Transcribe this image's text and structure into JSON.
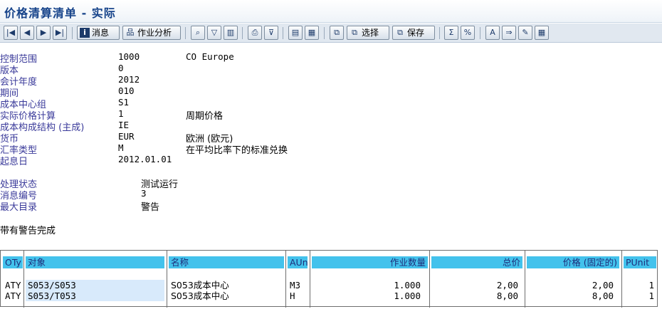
{
  "window": {
    "title": "价格清算清单 - 实际"
  },
  "toolbar": {
    "buttons": [
      {
        "icon": "first-page-icon",
        "glyph": "|◀",
        "label": ""
      },
      {
        "icon": "prev-page-icon",
        "glyph": "◀",
        "label": ""
      },
      {
        "icon": "next-page-icon",
        "glyph": "▶",
        "label": ""
      },
      {
        "icon": "last-page-icon",
        "glyph": "▶|",
        "label": ""
      },
      {
        "icon": "info-icon",
        "glyph": "i",
        "label": "消息"
      },
      {
        "icon": "hierarchy-icon",
        "glyph": "品",
        "label": "作业分析"
      },
      {
        "icon": "find-icon",
        "glyph": "⌕",
        "label": ""
      },
      {
        "icon": "filter-icon",
        "glyph": "▽",
        "label": ""
      },
      {
        "icon": "columns-icon",
        "glyph": "▥",
        "label": ""
      },
      {
        "icon": "print-icon",
        "glyph": "⎙",
        "label": ""
      },
      {
        "icon": "sort-filter-icon",
        "glyph": "⊽",
        "label": ""
      },
      {
        "icon": "export-icon",
        "glyph": "▤",
        "label": ""
      },
      {
        "icon": "export-list-icon",
        "glyph": "▦",
        "label": ""
      },
      {
        "icon": "copy-icon",
        "glyph": "⧉",
        "label": ""
      },
      {
        "icon": "select-layout-icon",
        "glyph": "⧉",
        "label": "选择"
      },
      {
        "icon": "save-layout-icon",
        "glyph": "⧉",
        "label": "保存"
      },
      {
        "icon": "sum-icon",
        "glyph": "Σ",
        "label": ""
      },
      {
        "icon": "subtotal-icon",
        "glyph": "%",
        "label": ""
      },
      {
        "icon": "abc-icon",
        "glyph": "A",
        "label": ""
      },
      {
        "icon": "transfer-icon",
        "glyph": "⇒",
        "label": ""
      },
      {
        "icon": "edit-icon",
        "glyph": "✎",
        "label": ""
      },
      {
        "icon": "spreadsheet-icon",
        "glyph": "▦",
        "label": ""
      }
    ]
  },
  "header_fields": [
    {
      "label": "控制范围",
      "value": "1000",
      "text": "CO Europe"
    },
    {
      "label": "版本",
      "value": "0",
      "text": ""
    },
    {
      "label": "会计年度",
      "value": "2012",
      "text": ""
    },
    {
      "label": "期间",
      "value": "010",
      "text": ""
    },
    {
      "label": "成本中心组",
      "value": "S1",
      "text": ""
    },
    {
      "label": "实际价格计算",
      "value": "1",
      "text": "周期价格"
    },
    {
      "label": "成本构成结构 (主成)",
      "value": "IE",
      "text": ""
    },
    {
      "label": "货币",
      "value": "EUR",
      "text": "欧洲 (欧元)"
    },
    {
      "label": "汇率类型",
      "value": "M",
      "text": "在平均比率下的标准兑换"
    },
    {
      "label": "起息日",
      "value": "2012.01.01",
      "text": ""
    }
  ],
  "status_fields": [
    {
      "label": "处理状态",
      "value": "测试运行"
    },
    {
      "label": "消息编号",
      "value": "3"
    },
    {
      "label": "最大目录",
      "value": "警告"
    }
  ],
  "completion_message": "带有警告完成",
  "table": {
    "columns": [
      "OTy",
      "对象",
      "名称",
      "AUn",
      "作业数量",
      "总价",
      "价格 (固定的)",
      "PUnit"
    ],
    "rows": [
      [
        "ATY",
        "S053/S053",
        "S053成本中心",
        "M3",
        "1.000",
        "2,00",
        "2,00",
        "1"
      ],
      [
        "ATY",
        "S053/T053",
        "S053成本中心",
        "H",
        "1.000",
        "8,00",
        "8,00",
        "1"
      ]
    ]
  }
}
